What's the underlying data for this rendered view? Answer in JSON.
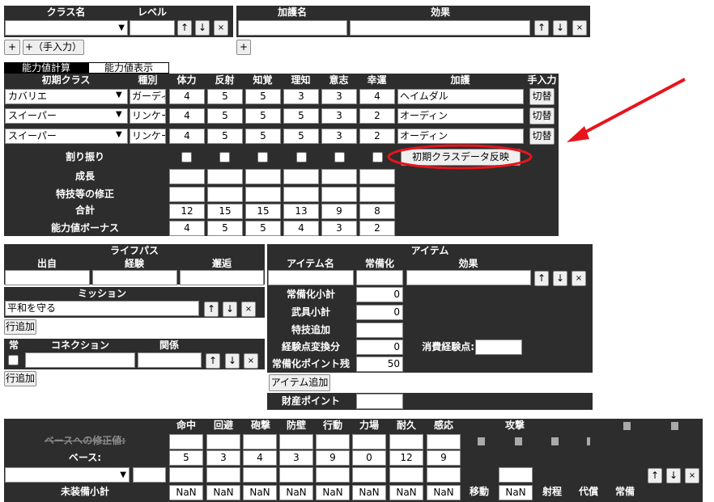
{
  "class_section": {
    "headers": [
      "クラス名",
      "レベル"
    ],
    "add_button": "+",
    "add_manual_button": "+（手入力）"
  },
  "blessing_section": {
    "headers": [
      "加護名",
      "効果"
    ],
    "add_button": "+"
  },
  "ability_tabs": [
    "能力値計算",
    "能力値表示"
  ],
  "ability_headers": [
    "初期クラス",
    "種別",
    "体力",
    "反射",
    "知覚",
    "理知",
    "意志",
    "幸運",
    "加護",
    "手入力"
  ],
  "ability_rows": [
    {
      "class": "カバリエ",
      "type": "ガーディ",
      "v": [
        "4",
        "5",
        "5",
        "3",
        "3",
        "4"
      ],
      "blessing": "ヘイムダル",
      "toggle": "切替"
    },
    {
      "class": "スイーパー",
      "type": "リンケー",
      "v": [
        "4",
        "5",
        "5",
        "5",
        "3",
        "2"
      ],
      "blessing": "オーディン",
      "toggle": "切替"
    },
    {
      "class": "スイーパー",
      "type": "リンケー",
      "v": [
        "4",
        "5",
        "5",
        "5",
        "3",
        "2"
      ],
      "blessing": "オーディン",
      "toggle": "切替"
    }
  ],
  "ability_labels": {
    "allocation": "割り振り",
    "growth": "成長",
    "special": "特技等の修正",
    "total": "合計",
    "bonus": "能力値ボーナス"
  },
  "reflect_button": "初期クラスデータ反映",
  "total_values": [
    "12",
    "15",
    "15",
    "13",
    "9",
    "8"
  ],
  "bonus_values": [
    "4",
    "5",
    "5",
    "4",
    "3",
    "2"
  ],
  "lifepath": {
    "title": "ライフパス",
    "headers": [
      "出自",
      "経験",
      "邂逅"
    ],
    "mission_header": "ミッション",
    "mission_value": "平和を守る",
    "add_row": "行追加",
    "connection_headers": [
      "常",
      "コネクション",
      "関係"
    ],
    "add_row2": "行追加"
  },
  "items": {
    "title": "アイテム",
    "headers": [
      "アイテム名",
      "常備化",
      "効果"
    ],
    "rows": [
      {
        "label": "常備化小計",
        "value": "0"
      },
      {
        "label": "武具小計",
        "value": "0"
      },
      {
        "label": "特技追加",
        "value": ""
      },
      {
        "label": "経験点変換分",
        "value": "0"
      },
      {
        "label": "常備化ポイント残",
        "value": "50"
      }
    ],
    "exp_label": "消費経験点:",
    "add_button": "アイテム追加",
    "assets_label": "財産ポイント"
  },
  "combat": {
    "headers": [
      "命中",
      "回避",
      "砲撃",
      "防壁",
      "行動",
      "力場",
      "耐久",
      "感応"
    ],
    "attack": "攻撃",
    "base_mod_label": "ベースへの修正値:",
    "base_label": "ベース:",
    "base_values": [
      "5",
      "3",
      "4",
      "3",
      "9",
      "0",
      "12",
      "9"
    ],
    "unequipped_label": "未装備小計",
    "nan": "NaN",
    "move": "移動",
    "range": "射程",
    "cost": "代償",
    "equip": "常備"
  },
  "controls": {
    "up": "↑",
    "down": "↓",
    "del": "×"
  },
  "annotation": {
    "arrow_color": "#e8141c",
    "ellipse_color": "#e8141c"
  }
}
